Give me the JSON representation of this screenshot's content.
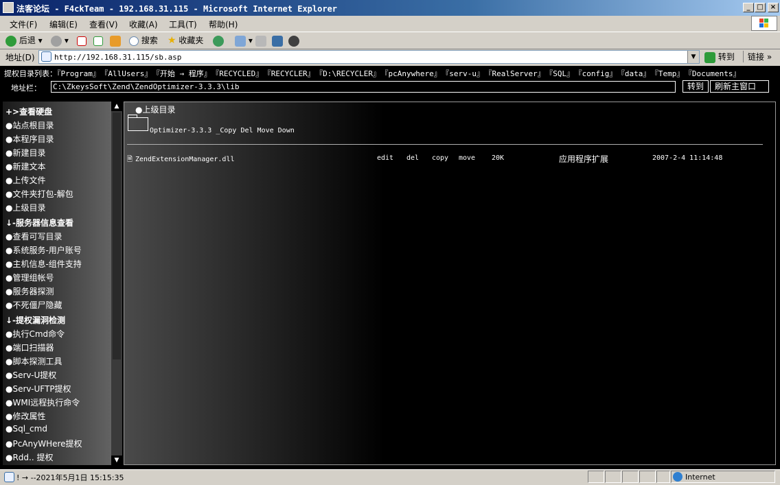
{
  "window": {
    "title": "法客论坛 - F4ckTeam - 192.168.31.115 - Microsoft Internet Explorer",
    "controls": [
      "_",
      "□",
      "×"
    ]
  },
  "menu": [
    "文件(F)",
    "编辑(E)",
    "查看(V)",
    "收藏(A)",
    "工具(T)",
    "帮助(H)"
  ],
  "toolbar": {
    "back": "后退",
    "search": "搜索",
    "favorites": "收藏夹"
  },
  "address": {
    "label": "地址(D)",
    "url": "http://192.168.31.115/sb.asp",
    "go": "转到",
    "links": "链接"
  },
  "webpage": {
    "dirlist_label": "提权目录列表：",
    "dirlinks": [
      "『Program』",
      "『AllUsers』",
      "『开始 → 程序』",
      "『RECYCLED』",
      "『RECYCLER』",
      "『D:\\RECYCLER』",
      "『pcAnywhere』",
      "『serv-u』",
      "『RealServer』",
      "『SQL』",
      "『config』",
      "『data』",
      "『Temp』",
      "『Documents』"
    ],
    "path_label": "地址栏：",
    "path_value": "C:\\ZkeysSoft\\Zend\\ZendOptimizer-3.3.3\\lib",
    "go_button": "转到",
    "refresh_button": "刷新主窗口",
    "sidebar": [
      {
        "text": "+>查看硬盘",
        "header": true
      },
      {
        "text": "●站点根目录"
      },
      {
        "text": "●本程序目录"
      },
      {
        "text": "●新建目录"
      },
      {
        "text": "●新建文本"
      },
      {
        "text": "●上传文件"
      },
      {
        "text": "●文件夹打包-解包"
      },
      {
        "text": "●上级目录"
      },
      {
        "text": "↓-服务器信息查看",
        "header": true
      },
      {
        "text": "●查看可写目录"
      },
      {
        "text": "●系统服务-用户账号"
      },
      {
        "text": "●主机信息-组件支持"
      },
      {
        "text": "●管理组帐号"
      },
      {
        "text": "●服务器探测"
      },
      {
        "text": "●不死僵尸隐藏"
      },
      {
        "text": "↓-提权漏洞检测",
        "header": true
      },
      {
        "text": "●执行Cmd命令"
      },
      {
        "text": "●端口扫描器"
      },
      {
        "text": "●脚本探测工具"
      },
      {
        "text": "●Serv-U提权"
      },
      {
        "text": "●Serv-UFTP提权"
      },
      {
        "text": "●WMI远程执行命令"
      },
      {
        "text": "●修改属性"
      },
      {
        "text": "●Sql_cmd"
      },
      {
        "text": "●PcAnyWHere提权"
      },
      {
        "text": "●Rdd.. 提权"
      }
    ],
    "updir": "●上级目录",
    "folder": {
      "name": "Optimizer-3.3.3",
      "actions": "_Copy Del Move Down"
    },
    "files": [
      {
        "name": "ZendExtensionManager.dll",
        "edit": "edit",
        "del": "del",
        "copy": "copy",
        "move": "move",
        "size": "20K",
        "type": "应用程序扩展",
        "date": "2007-2-4 11:14:48"
      }
    ]
  },
  "status": {
    "text": "! →  --2021年5月1日 15:15:35",
    "zone": "Internet"
  }
}
